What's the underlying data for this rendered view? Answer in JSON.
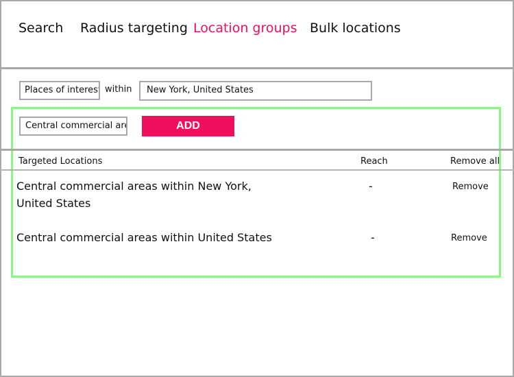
{
  "tabs": [
    {
      "label": "Search",
      "active": false
    },
    {
      "label": "Radius targeting",
      "active": false
    },
    {
      "label": "Location groups",
      "active": true
    },
    {
      "label": "Bulk locations",
      "active": false
    }
  ],
  "form": {
    "poi_type": "Places of interest",
    "within_label": "within",
    "location": "New York, United States",
    "category": "Central commercial areas",
    "add_label": "ADD"
  },
  "table": {
    "headers": {
      "location": "Targeted Locations",
      "reach": "Reach",
      "remove_all": "Remove all"
    },
    "rows": [
      {
        "name": "Central commercial areas within New York, United States",
        "reach": "-",
        "remove_label": "Remove"
      },
      {
        "name": "Central commercial areas within United States",
        "reach": "-",
        "remove_label": "Remove"
      }
    ]
  },
  "colors": {
    "accent": "#f00f5f",
    "highlight_border": "#8ff28a",
    "divider": "#a8a8a8"
  }
}
